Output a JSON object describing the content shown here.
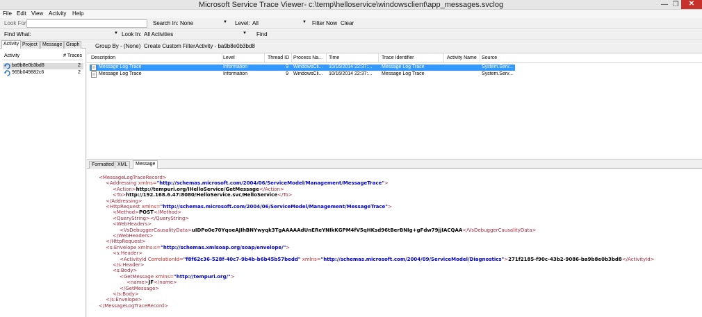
{
  "window": {
    "title": "Microsoft Service Trace Viewer- c:\\temp\\helloservice\\windowsclient\\app_messages.svclog",
    "minimize": "—",
    "maximize": "❐",
    "close": "✕"
  },
  "menu": [
    "File",
    "Edit",
    "View",
    "Activity",
    "Help"
  ],
  "toolbar1": {
    "look_for_label": "Look For",
    "look_for_value": "",
    "search_in_label": "Search In:",
    "search_in_value": "None",
    "level_label": "Level:",
    "level_value": "All",
    "filter_now": "Filter Now",
    "clear": "Clear"
  },
  "toolbar2": {
    "find_what_label": "Find What:",
    "find_what_value": "",
    "look_in_label": "Look In:",
    "look_in_value": "All Activities",
    "find": "Find"
  },
  "left_pane": {
    "tabs": [
      "Activity",
      "Project",
      "Message",
      "Graph"
    ],
    "active_tab": "Activity",
    "headers": {
      "activity": "Activity",
      "traces": "# Traces"
    },
    "rows": [
      {
        "name": "ba9b8e0b3bd8",
        "count": "2",
        "selected": true
      },
      {
        "name": "965b049882c6",
        "count": "2",
        "selected": false
      }
    ]
  },
  "right_toolbar": {
    "group_by": "Group By - (None)",
    "create_filter": "Create Custom Filter",
    "activity": "Activity - ba9b8e0b3bd8"
  },
  "trace_grid": {
    "headers": [
      "Description",
      "Level",
      "Thread ID",
      "Process Na...",
      "Time",
      "Trace Identifier",
      "Activity Name",
      "Source"
    ],
    "rows": [
      {
        "description": "Message Log Trace",
        "level": "Information",
        "thread_id": "9",
        "process": "WindowsCli...",
        "time": "10/16/2014 22:37:...",
        "trace_id": "Message Log Trace",
        "activity_name": "",
        "source": "System.Serv...",
        "selected": true
      },
      {
        "description": "Message Log Trace",
        "level": "Information",
        "thread_id": "9",
        "process": "WindowsCli...",
        "time": "10/16/2014 22:37:...",
        "trace_id": "Message Log Trace",
        "activity_name": "",
        "source": "System.Serv...",
        "selected": false
      }
    ]
  },
  "detail_tabs": [
    "Formatted",
    "XML",
    "Message"
  ],
  "active_detail_tab": "Message",
  "xml_lines": [
    {
      "parts": [
        [
          "tag",
          "<MessageLogTraceRecord>"
        ]
      ]
    },
    {
      "parts": [
        [
          "tag",
          "<Addressing "
        ],
        [
          "att",
          "xmlns="
        ],
        [
          "val",
          "\"http://schemas.microsoft.com/2004/06/ServiceModel/Management/MessageTrace\""
        ],
        [
          "tag",
          ">"
        ]
      ]
    },
    {
      "parts": [
        [
          "tag",
          "<Action>"
        ],
        [
          "txt",
          "http://tempuri.org/IHelloService/GetMessage"
        ],
        [
          "tag",
          "</Action>"
        ]
      ]
    },
    {
      "parts": [
        [
          "tag",
          "<To>"
        ],
        [
          "txt",
          "http://192.168.6.47:8080/HelloService.svc/HelloService"
        ],
        [
          "tag",
          "</To>"
        ]
      ]
    },
    {
      "parts": [
        [
          "tag",
          "</Addressing>"
        ]
      ]
    },
    {
      "parts": [
        [
          "tag",
          "<HttpRequest "
        ],
        [
          "att",
          "xmlns="
        ],
        [
          "val",
          "\"http://schemas.microsoft.com/2004/06/ServiceModel/Management/MessageTrace\""
        ],
        [
          "tag",
          ">"
        ]
      ]
    },
    {
      "parts": [
        [
          "tag",
          "<Method>"
        ],
        [
          "txt",
          "POST"
        ],
        [
          "tag",
          "</Method>"
        ]
      ]
    },
    {
      "parts": [
        [
          "tag",
          "<QueryString></QueryString>"
        ]
      ]
    },
    {
      "parts": [
        [
          "tag",
          "<WebHeaders>"
        ]
      ]
    },
    {
      "parts": [
        [
          "tag",
          "<VsDebuggerCausalityData>"
        ],
        [
          "txt",
          "uIDPo0e70YqoeAJIhBNYwyqk3TgAAAAAdUnEReYNIkKGPM4fV5qHKsd96tBerBNIg+gFdw79jjIACQAA"
        ],
        [
          "tag",
          "</VsDebuggerCausalityData>"
        ]
      ]
    },
    {
      "parts": [
        [
          "tag",
          "</WebHeaders>"
        ]
      ]
    },
    {
      "parts": [
        [
          "tag",
          "</HttpRequest>"
        ]
      ]
    },
    {
      "parts": [
        [
          "tag",
          "<s:Envelope "
        ],
        [
          "att",
          "xmlns:s="
        ],
        [
          "val",
          "\"http://schemas.xmlsoap.org/soap/envelope/\""
        ],
        [
          "tag",
          ">"
        ]
      ]
    },
    {
      "parts": [
        [
          "tag",
          "<s:Header>"
        ]
      ]
    },
    {
      "parts": [
        [
          "tag",
          "<ActivityId "
        ],
        [
          "att",
          "CorrelationId="
        ],
        [
          "val",
          "\"f8f62c36-528f-40c7-9b4b-b6b45b57bedd\""
        ],
        [
          "att",
          " xmlns="
        ],
        [
          "val",
          "\"http://schemas.microsoft.com/2004/09/ServiceModel/Diagnostics\""
        ],
        [
          "tag",
          ">"
        ],
        [
          "txt",
          "271f2185-f90c-43b2-9086-ba9b8e0b3bd8"
        ],
        [
          "tag",
          "</ActivityId>"
        ]
      ]
    },
    {
      "parts": [
        [
          "tag",
          "</s:Header>"
        ]
      ]
    },
    {
      "parts": [
        [
          "tag",
          "<s:Body>"
        ]
      ]
    },
    {
      "parts": [
        [
          "tag",
          "<GetMessage "
        ],
        [
          "att",
          "xmlns="
        ],
        [
          "val",
          "\"http://tempuri.org/\""
        ],
        [
          "tag",
          ">"
        ]
      ]
    },
    {
      "parts": [
        [
          "tag",
          "<name>"
        ],
        [
          "txt",
          "JF"
        ],
        [
          "tag",
          "</name>"
        ]
      ]
    },
    {
      "parts": [
        [
          "tag",
          "</GetMessage>"
        ]
      ]
    },
    {
      "parts": [
        [
          "tag",
          "</s:Body>"
        ]
      ]
    },
    {
      "parts": [
        [
          "tag",
          "</s:Envelope>"
        ]
      ]
    },
    {
      "parts": [
        [
          "tag",
          "</MessageLogTraceRecord>"
        ]
      ]
    }
  ]
}
